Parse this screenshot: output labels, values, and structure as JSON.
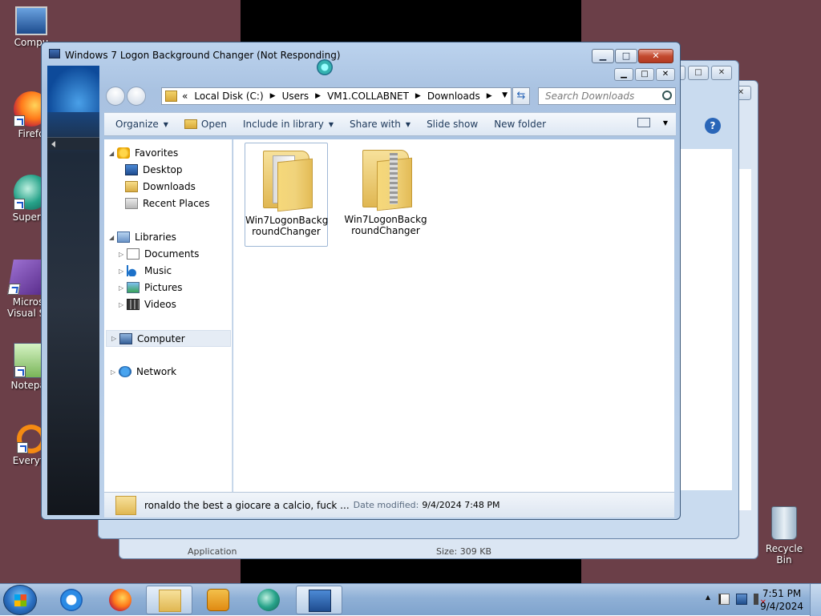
{
  "desktop_icons": [
    {
      "label": "Compu",
      "icon": "computer-icon"
    },
    {
      "label": "Firefo",
      "icon": "firefox-icon"
    },
    {
      "label": "Superm",
      "icon": "supermium-icon"
    },
    {
      "label": "Micros",
      "label2": "Visual St",
      "icon": "visual-studio-icon"
    },
    {
      "label": "Notepad",
      "icon": "notepad-icon"
    },
    {
      "label": "Everyth",
      "icon": "everything-icon"
    }
  ],
  "recycle_bin": {
    "label": "Recycle Bin"
  },
  "back_window": {
    "status_type": "Application",
    "status_size": "Size: 309 KB"
  },
  "main_window": {
    "title": "Windows 7 Logon Background Changer (Not Responding)"
  },
  "address_bar": {
    "prefix": "«",
    "crumbs": [
      "Local Disk (C:)",
      "Users",
      "VM1.COLLABNET",
      "Downloads"
    ],
    "search_placeholder": "Search Downloads"
  },
  "toolbar": {
    "organize": "Organize",
    "open": "Open",
    "include": "Include in library",
    "share": "Share with",
    "slideshow": "Slide show",
    "new_folder": "New folder",
    "help": "?"
  },
  "nav_pane": {
    "favorites": "Favorites",
    "desktop": "Desktop",
    "downloads": "Downloads",
    "recent": "Recent Places",
    "libraries": "Libraries",
    "documents": "Documents",
    "music": "Music",
    "pictures": "Pictures",
    "videos": "Videos",
    "computer": "Computer",
    "network": "Network"
  },
  "files": [
    {
      "line1": "Win7LogonBackg",
      "line2": "roundChanger",
      "type": "folder"
    },
    {
      "line1": "Win7LogonBackg",
      "line2": "roundChanger",
      "type": "zip"
    }
  ],
  "status_bar": {
    "name": "ronaldo the best a giocare a calcio, fuck ...",
    "date_label": "Date modified:",
    "date_value": "9/4/2024 7:48 PM"
  },
  "clock": {
    "time": "7:51 PM",
    "date": "9/4/2024"
  }
}
